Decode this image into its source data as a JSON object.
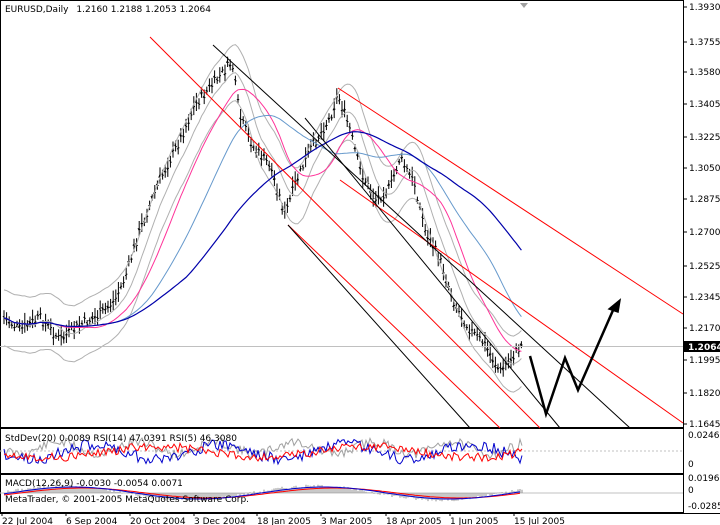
{
  "title": {
    "symbol": "EURUSD,Daily",
    "ohlc": "1.2160 1.2188 1.2053 1.2064"
  },
  "current_price": "1.2064",
  "price_axis": [
    "1.3930",
    "1.3755",
    "1.3580",
    "1.3405",
    "1.3225",
    "1.3050",
    "1.2875",
    "1.2700",
    "1.2525",
    "1.2345",
    "1.2170",
    "1.1995",
    "1.1820",
    "1.1645"
  ],
  "indicator1": {
    "label": "StdDev(20) 0.0089  RSI(14) 47.0391  RSI(5) 46.3080",
    "axis": [
      "0.0246",
      "0"
    ]
  },
  "indicator2": {
    "label": "MACD(12,26,9) -0.0030 -0.0054 0.0071",
    "copyright": "MetaTrader, © 2001-2005 MetaQuotes Software Corp.",
    "axis": [
      "0.0196",
      "0",
      "-0.0285"
    ]
  },
  "date_axis": [
    "22 Jul 2004",
    "6 Sep 2004",
    "20 Oct 2004",
    "3 Dec 2004",
    "18 Jan 2005",
    "3 Mar 2005",
    "18 Apr 2005",
    "1 Jun 2005",
    "15 Jul 2005"
  ],
  "colors": {
    "candle": "#000000",
    "channel_red": "#ff0000",
    "channel_black": "#000000",
    "bollinger": "#b0b0b0",
    "ma_fast": "#ff3399",
    "ma_mid": "#6699cc",
    "ma_slow": "#0000aa",
    "price_box": "#000000"
  }
}
